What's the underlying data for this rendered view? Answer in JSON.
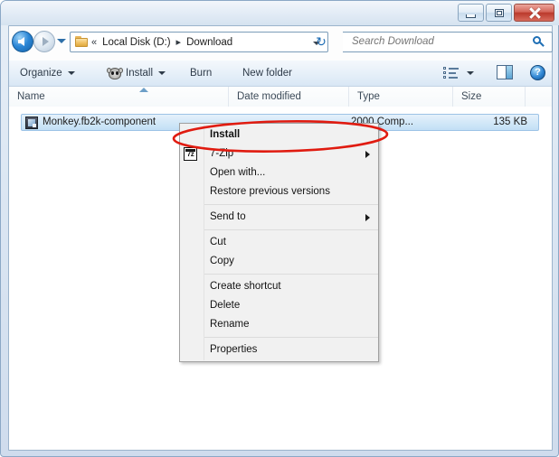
{
  "window": {
    "title": "",
    "buttons": {
      "minimize": "Minimize",
      "maximize": "Restore",
      "close": "Close"
    }
  },
  "navigation": {
    "back": "Back",
    "forward": "Forward",
    "recent_pages": "Recent Pages",
    "refresh_glyph": "↻",
    "address_dropdown": "Previous Locations"
  },
  "address_bar": {
    "overflow_chevron": "«",
    "crumbs": [
      {
        "label": "Local Disk (D:)",
        "separator": "▸"
      },
      {
        "label": "Download",
        "separator": ""
      }
    ],
    "folder_icon": "folder-icon"
  },
  "search": {
    "placeholder": "Search Download",
    "value": "",
    "icon": "search-icon"
  },
  "toolbar": {
    "organize": "Organize",
    "install": "Install",
    "install_icon": "monkey-icon",
    "burn": "Burn",
    "new_folder": "New folder",
    "view_icon": "view-layout-icon",
    "preview_pane_icon": "preview-pane-icon",
    "help_icon": "?",
    "help_label": "Help"
  },
  "columns": [
    {
      "key": "name",
      "label": "Name",
      "sorted": true
    },
    {
      "key": "date",
      "label": "Date modified",
      "sorted": false
    },
    {
      "key": "type",
      "label": "Type",
      "sorted": false
    },
    {
      "key": "size",
      "label": "Size",
      "sorted": false
    }
  ],
  "files": [
    {
      "name": "Monkey.fb2k-component",
      "date_modified": "",
      "type": "2000 Comp...",
      "size": "135 KB",
      "selected": true,
      "icon": "component-file-icon"
    }
  ],
  "context_menu": {
    "items": [
      {
        "label": "Install",
        "bold": true,
        "submenu": false,
        "icon": ""
      },
      {
        "label": "7-Zip",
        "bold": false,
        "submenu": true,
        "icon": "7z"
      },
      {
        "label": "Open with...",
        "bold": false,
        "submenu": false,
        "icon": ""
      },
      {
        "label": "Restore previous versions",
        "bold": false,
        "submenu": false,
        "icon": ""
      },
      {
        "separator": true
      },
      {
        "label": "Send to",
        "bold": false,
        "submenu": true,
        "icon": ""
      },
      {
        "separator": true
      },
      {
        "label": "Cut",
        "bold": false,
        "submenu": false,
        "icon": ""
      },
      {
        "label": "Copy",
        "bold": false,
        "submenu": false,
        "icon": ""
      },
      {
        "separator": true
      },
      {
        "label": "Create shortcut",
        "bold": false,
        "submenu": false,
        "icon": ""
      },
      {
        "label": "Delete",
        "bold": false,
        "submenu": false,
        "icon": ""
      },
      {
        "label": "Rename",
        "bold": false,
        "submenu": false,
        "icon": ""
      },
      {
        "separator": true
      },
      {
        "label": "Properties",
        "bold": false,
        "submenu": false,
        "icon": ""
      }
    ]
  },
  "annotation": {
    "shape": "ellipse",
    "color": "#e01b10",
    "target": "Install"
  },
  "colors": {
    "accent": "#2f86d4",
    "selection": "#c2dff5",
    "selection_border": "#9dc3e6",
    "annotation_red": "#e01b10",
    "close_button": "#ba392c",
    "frame": "#cfdced"
  }
}
